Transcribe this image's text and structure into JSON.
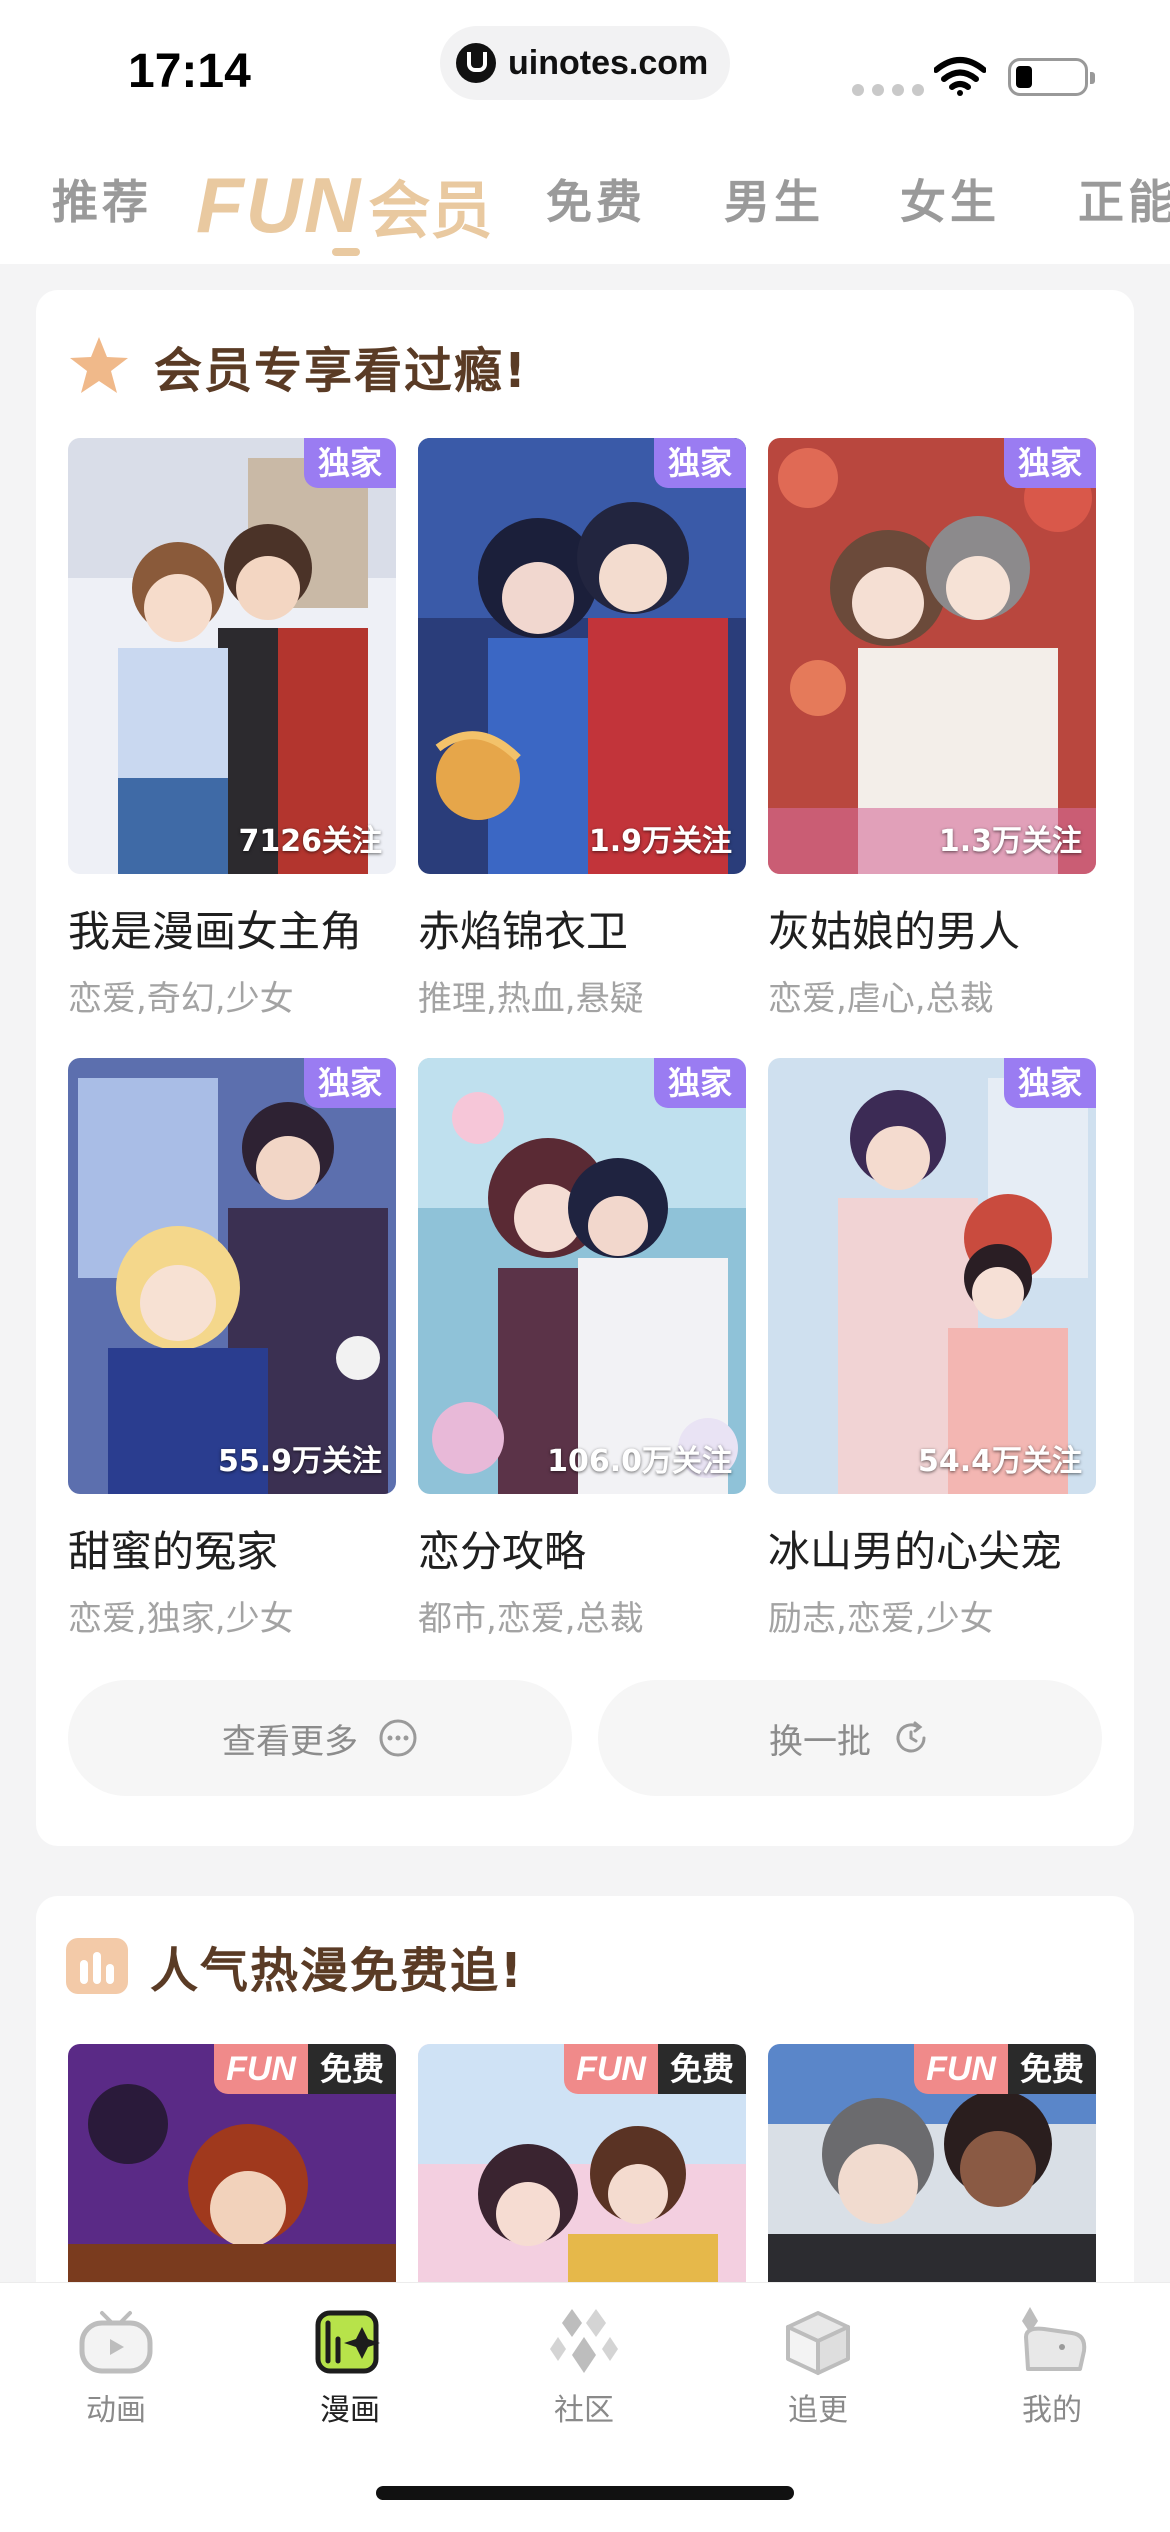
{
  "status_bar": {
    "time": "17:14",
    "url": "uinotes.com"
  },
  "top_tabs": {
    "items": [
      "推荐",
      "免费",
      "男生",
      "女生",
      "正能"
    ],
    "fun_logo_latin": "FUN",
    "fun_logo_cn": "会员"
  },
  "member_section": {
    "title": "会员专享看过瘾!",
    "exclusive_label": "独家",
    "comics": [
      {
        "name": "我是漫画女主角",
        "tags": "恋爱,奇幻,少女",
        "follows": "7126关注"
      },
      {
        "name": "赤焰锦衣卫",
        "tags": "推理,热血,悬疑",
        "follows": "1.9万关注"
      },
      {
        "name": "灰姑娘的男人",
        "tags": "恋爱,虐心,总裁",
        "follows": "1.3万关注"
      },
      {
        "name": "甜蜜的冤家",
        "tags": "恋爱,独家,少女",
        "follows": "55.9万关注"
      },
      {
        "name": "恋分攻略",
        "tags": "都市,恋爱,总裁",
        "follows": "106.0万关注"
      },
      {
        "name": "冰山男的心尖宠",
        "tags": "励志,恋爱,少女",
        "follows": "54.4万关注"
      }
    ],
    "more_button": "查看更多",
    "refresh_button": "换一批"
  },
  "free_section": {
    "title": "人气热漫免费追!",
    "badge_fun": "FUN",
    "badge_free": "免费"
  },
  "bottom_nav": {
    "items": [
      {
        "label": "动画",
        "icon": "tv-icon"
      },
      {
        "label": "漫画",
        "icon": "comic-book-icon"
      },
      {
        "label": "社区",
        "icon": "diamonds-icon"
      },
      {
        "label": "追更",
        "icon": "box-icon"
      },
      {
        "label": "我的",
        "icon": "profile-icon"
      }
    ],
    "active_index": 1
  },
  "colors": {
    "accent_purple": "#9a7cf2",
    "fun_gold": "#e9c9a0",
    "section_title": "#5a3b25",
    "nav_active": "#b7e34a"
  }
}
